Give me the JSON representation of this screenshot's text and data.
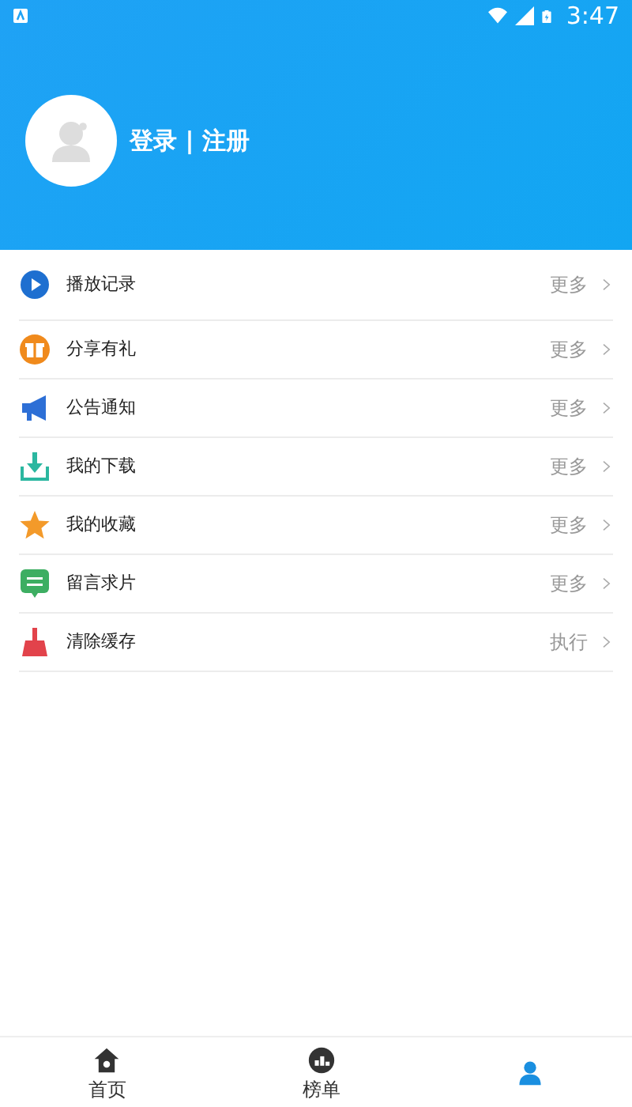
{
  "status_bar": {
    "time": "3:47"
  },
  "profile": {
    "login_text": "登录 | 注册"
  },
  "menu": [
    {
      "kind": "play",
      "label": "播放记录",
      "action": "更多"
    },
    {
      "kind": "gift",
      "label": "分享有礼",
      "action": "更多"
    },
    {
      "kind": "megaphone",
      "label": "公告通知",
      "action": "更多"
    },
    {
      "kind": "download",
      "label": "我的下载",
      "action": "更多"
    },
    {
      "kind": "star",
      "label": "我的收藏",
      "action": "更多"
    },
    {
      "kind": "message",
      "label": "留言求片",
      "action": "更多"
    },
    {
      "kind": "broom",
      "label": "清除缓存",
      "action": "执行"
    }
  ],
  "bottom_nav": [
    {
      "kind": "home",
      "label": "首页",
      "selected": false
    },
    {
      "kind": "chart",
      "label": "榜单",
      "selected": false
    },
    {
      "kind": "person",
      "selected": true
    }
  ]
}
